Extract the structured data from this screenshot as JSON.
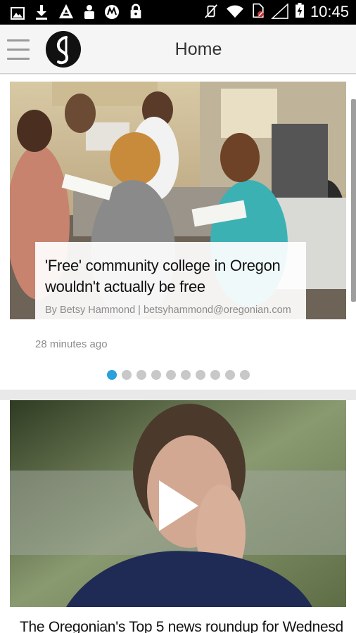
{
  "status_bar": {
    "time": "10:45",
    "left_icons": [
      "image-icon",
      "download-icon",
      "app-icon",
      "user-icon",
      "motorola-icon",
      "lock-icon"
    ],
    "right_icons": [
      "mute-vibrate-icon",
      "wifi-icon",
      "no-sim-icon",
      "signal-icon",
      "battery-charging-icon"
    ]
  },
  "app_bar": {
    "title": "Home",
    "menu_icon": "hamburger-menu-icon",
    "logo_icon": "oregonian-logo-icon"
  },
  "featured": {
    "headline": "'Free' community college in Oregon wouldn't actually be free",
    "byline": "By Betsy Hammond | betsyhammond@oregonian.com",
    "timestamp": "28 minutes ago",
    "carousel": {
      "total": 10,
      "active_index": 0
    }
  },
  "second_card": {
    "headline": "The Oregonian's Top 5 news roundup for Wednesd",
    "play_icon": "play-icon"
  },
  "colors": {
    "accent": "#2aa0dc",
    "status_bar": "#000000",
    "app_bar": "#f5f5f5"
  }
}
